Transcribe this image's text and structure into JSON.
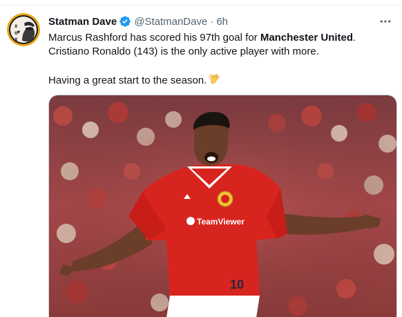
{
  "tweet": {
    "author": {
      "display_name": "Statman Dave",
      "handle": "@StatmanDave",
      "verified": true
    },
    "separator": "·",
    "timestamp": "6h",
    "text": {
      "line1_prefix": "Marcus Rashford has scored his 97th goal for ",
      "line1_bold": "Manchester United",
      "line1_suffix": ".",
      "line2": "Cristiano Ronaldo (143) is the only active player with more.",
      "line3": "Having a great start to the season."
    },
    "emoji": "clapping-hands",
    "colors": {
      "verified_badge": "#1d9bf0",
      "secondary_text": "#536471",
      "primary_text": "#0f1419",
      "jersey_red": "#d8241e"
    },
    "media": {
      "shirt_sponsor": "TeamViewer",
      "shirt_number": "10"
    }
  }
}
